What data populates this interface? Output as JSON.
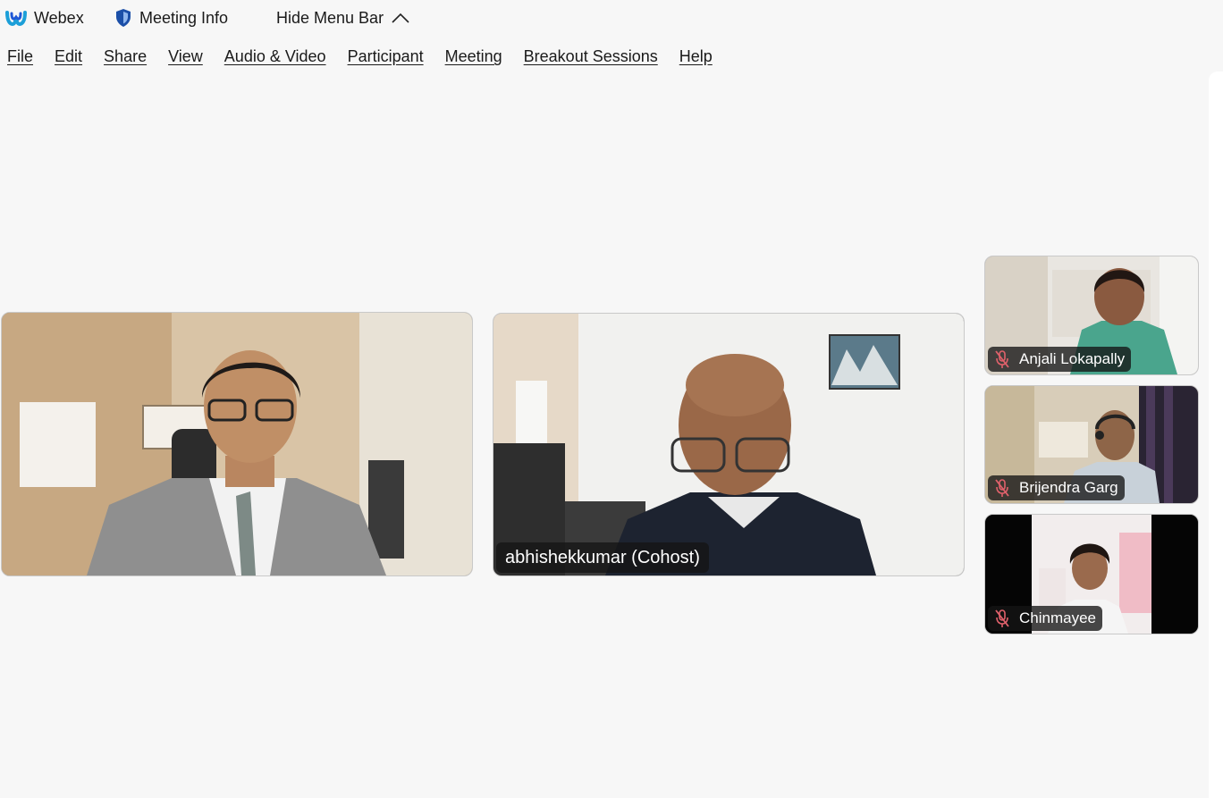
{
  "titlebar": {
    "app_name": "Webex",
    "meeting_info_label": "Meeting Info",
    "hide_menu_label": "Hide Menu Bar",
    "app_icon": "webex-logo-icon",
    "meeting_info_icon": "shield-icon",
    "hide_menu_icon": "chevron-up-icon"
  },
  "menu": {
    "items": [
      {
        "label": "File"
      },
      {
        "label": "Edit"
      },
      {
        "label": "Share"
      },
      {
        "label": "View"
      },
      {
        "label": "Audio & Video"
      },
      {
        "label": "Participant"
      },
      {
        "label": "Meeting"
      },
      {
        "label": "Breakout Sessions"
      },
      {
        "label": "Help"
      }
    ]
  },
  "stage": {
    "main_tiles": [
      {
        "name": ""
      },
      {
        "name": "abhishekkumar (Cohost)"
      }
    ],
    "thumbnails": [
      {
        "name": "Anjali Lokapally",
        "muted": true
      },
      {
        "name": "Brijendra Garg",
        "muted": true
      },
      {
        "name": "Chinmayee",
        "muted": true
      }
    ]
  },
  "colors": {
    "background": "#f7f7f7",
    "nameplate": "#141414",
    "muted_icon": "#e0616b",
    "webex_blue": "#1170cf"
  }
}
